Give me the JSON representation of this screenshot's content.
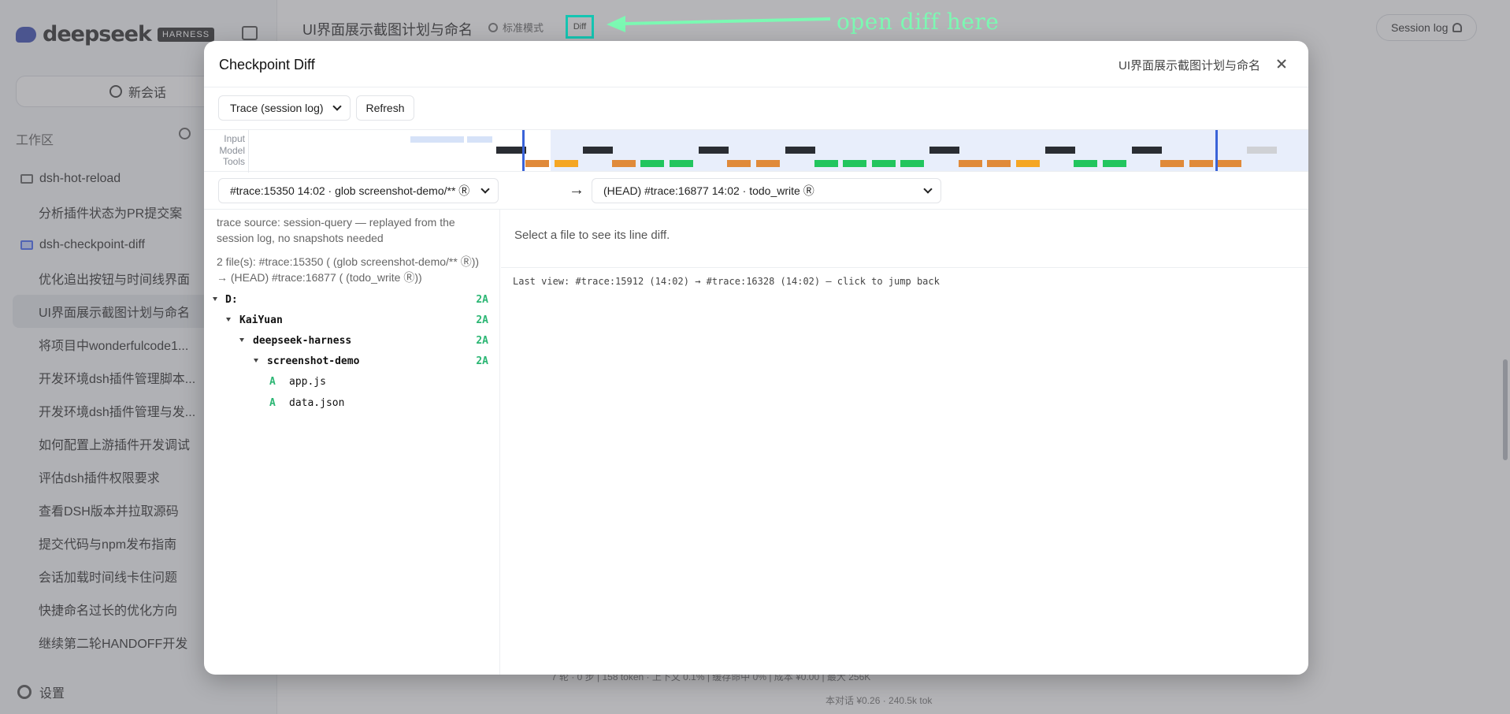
{
  "background": {
    "logo_text": "deepseek",
    "logo_badge": "HARNESS",
    "new_chat_label": "新会话",
    "section_label": "工作区",
    "items": [
      {
        "label": "dsh-hot-reload",
        "kind": "folder"
      },
      {
        "label": "分析插件状态为PR提交案",
        "kind": "sub"
      },
      {
        "label": "dsh-checkpoint-diff",
        "kind": "folder-active"
      },
      {
        "label": "优化追出按钮与时间线界面",
        "kind": "sub"
      },
      {
        "label": "UI界面展示截图计划与命名",
        "kind": "sub-active"
      },
      {
        "label": "将项目中wonderfulcode1...",
        "kind": "sub"
      },
      {
        "label": "开发环境dsh插件管理脚本...",
        "kind": "sub"
      },
      {
        "label": "开发环境dsh插件管理与发...",
        "kind": "sub"
      },
      {
        "label": "如何配置上游插件开发调试",
        "kind": "sub"
      },
      {
        "label": "评估dsh插件权限要求",
        "kind": "sub"
      },
      {
        "label": "查看DSH版本并拉取源码",
        "kind": "sub"
      },
      {
        "label": "提交代码与npm发布指南",
        "kind": "sub"
      },
      {
        "label": "会话加载时间线卡住问题",
        "kind": "sub"
      },
      {
        "label": "快捷命名过长的优化方向",
        "kind": "sub"
      },
      {
        "label": "继续第二轮HANDOFF开发",
        "kind": "sub"
      }
    ],
    "settings_label": "设置",
    "header_title": "UI界面展示截图计划与命名",
    "mode_label": "标准模式",
    "diff_button_label": "Diff",
    "session_log_label": "Session log",
    "footer_line1": "7 轮 · 0 步 | 158 token · 上下文 0.1% | 缓存命中 0% | 成本 ¥0.00 | 最大 256K",
    "footer_line2": "本对话 ¥0.26 · 240.5k tok"
  },
  "annotation": {
    "text": "open diff here",
    "color": "#7cf9b3",
    "highlight_color": "#14c5b2"
  },
  "modal": {
    "title": "Checkpoint Diff",
    "subtitle": "UI界面展示截图计划与命名",
    "toolbar": {
      "mode_selected": "Trace (session log)",
      "refresh_label": "Refresh"
    },
    "timeline": {
      "lanes": [
        "Input",
        "Model",
        "Tools"
      ],
      "selection_color": "#e8eefb",
      "handle_color": "#3a63d8"
    },
    "range": {
      "from_label": "#trace:15350 14:02 · glob screenshot-demo/** Ⓡ",
      "arrow": "→",
      "to_label": "(HEAD) #trace:16877 14:02 · todo_write Ⓡ"
    },
    "left": {
      "trace_source": "trace source: session-query — replayed from the session log, no snapshots needed",
      "file_summary": "2 file(s): #trace:15350 ( (glob screenshot-demo/** Ⓡ)) → (HEAD) #trace:16877 ( (todo_write Ⓡ))",
      "tree": [
        {
          "name": "D:",
          "count": "2A"
        },
        {
          "name": "KaiYuan",
          "count": "2A"
        },
        {
          "name": "deepseek-harness",
          "count": "2A"
        },
        {
          "name": "screenshot-demo",
          "count": "2A"
        },
        {
          "name": "app.js",
          "status": "A"
        },
        {
          "name": "data.json",
          "status": "A"
        }
      ]
    },
    "right": {
      "empty_hint": "Select a file to see its line diff.",
      "last_view": "Last view: #trace:15912 (14:02) → #trace:16328 (14:02) — click to jump back"
    }
  }
}
